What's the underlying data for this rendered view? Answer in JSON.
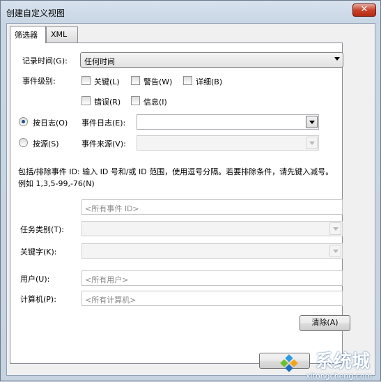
{
  "window": {
    "title": "创建自定义视图",
    "close_glyph": "✕"
  },
  "tabs": [
    {
      "label": "筛选器"
    },
    {
      "label": "XML"
    }
  ],
  "filter": {
    "logged_label": "记录时间(G):",
    "logged_value": "任何时间",
    "level_label": "事件级别:",
    "levels": {
      "critical": "关键(L)",
      "warning": "警告(W)",
      "verbose": "详细(B)",
      "error": "错误(R)",
      "information": "信息(I)"
    },
    "by_log_label": "按日志(O)",
    "by_source_label": "按源(S)",
    "event_logs_label": "事件日志(E):",
    "event_sources_label": "事件来源(V):",
    "description": "包括/排除事件 ID: 输入 ID 号和/或 ID 范围，使用逗号分隔。若要排除条件，请先键入减号。例如 1,3,5-99,-76(N)",
    "event_ids_placeholder": "<所有事件 ID>",
    "task_category_label": "任务类别(T):",
    "keywords_label": "关键字(K):",
    "user_label": "用户(U):",
    "user_placeholder": "<所有用户>",
    "computer_label": "计算机(P):",
    "computer_placeholder": "<所有计算机>",
    "clear_button": "清除(A)"
  },
  "watermark": {
    "brand": "系统城",
    "url": "xitongcheng.com"
  }
}
